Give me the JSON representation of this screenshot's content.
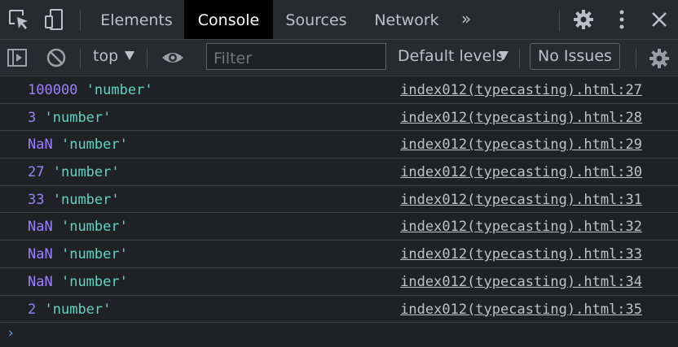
{
  "tabs": [
    {
      "label": "Elements",
      "active": false
    },
    {
      "label": "Console",
      "active": true
    },
    {
      "label": "Sources",
      "active": false
    },
    {
      "label": "Network",
      "active": false
    }
  ],
  "toolbar": {
    "context": "top",
    "filter_placeholder": "Filter",
    "levels": "Default levels",
    "issues": "No Issues"
  },
  "icons": {
    "inspect": "inspect-element-icon",
    "device": "device-toolbar-icon",
    "more_tabs": "chevron-double-right-icon",
    "settings": "gear-icon",
    "menu": "kebab-menu-icon",
    "close": "close-icon",
    "sidebar": "console-sidebar-icon",
    "clear": "clear-console-icon",
    "eye": "live-expression-icon"
  },
  "colors": {
    "number": "#9980ff",
    "string": "#5cd5c4",
    "link": "#c2c2c2",
    "prompt": "#5c9eff"
  },
  "logs": [
    {
      "value": "100000",
      "type": "'number'",
      "source": "index012(typecasting).html:27"
    },
    {
      "value": "3",
      "type": "'number'",
      "source": "index012(typecasting).html:28"
    },
    {
      "value": "NaN",
      "type": "'number'",
      "source": "index012(typecasting).html:29"
    },
    {
      "value": "27",
      "type": "'number'",
      "source": "index012(typecasting).html:30"
    },
    {
      "value": "33",
      "type": "'number'",
      "source": "index012(typecasting).html:31"
    },
    {
      "value": "NaN",
      "type": "'number'",
      "source": "index012(typecasting).html:32"
    },
    {
      "value": "NaN",
      "type": "'number'",
      "source": "index012(typecasting).html:33"
    },
    {
      "value": "NaN",
      "type": "'number'",
      "source": "index012(typecasting).html:34"
    },
    {
      "value": "2",
      "type": "'number'",
      "source": "index012(typecasting).html:35"
    }
  ],
  "prompt": "›"
}
